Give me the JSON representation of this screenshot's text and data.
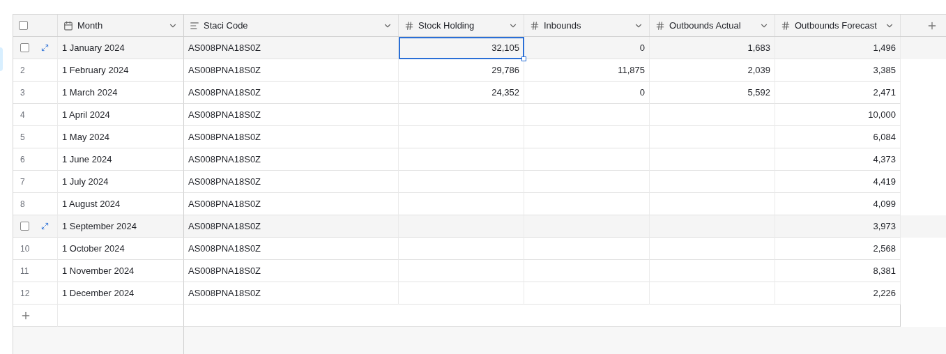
{
  "select_all": {
    "checked": false
  },
  "columns": [
    {
      "label": "Month",
      "kind": "date"
    },
    {
      "label": "Staci Code",
      "kind": "text"
    },
    {
      "label": "Stock Holding",
      "kind": "number"
    },
    {
      "label": "Inbounds",
      "kind": "number"
    },
    {
      "label": "Outbounds Actual",
      "kind": "number"
    },
    {
      "label": "Outbounds Forecast",
      "kind": "number"
    }
  ],
  "rows": [
    {
      "hovered": true,
      "month": "1 January 2024",
      "code": "AS008PNA18S0Z",
      "values": [
        {
          "text": "32,105",
          "selected": true
        },
        {
          "text": "0",
          "selected": false
        },
        {
          "text": "1,683",
          "selected": false
        },
        {
          "text": "1,496",
          "selected": false
        }
      ]
    },
    {
      "number": "2",
      "hovered": false,
      "month": "1 February 2024",
      "code": "AS008PNA18S0Z",
      "values": [
        {
          "text": "29,786",
          "selected": false
        },
        {
          "text": "11,875",
          "selected": false
        },
        {
          "text": "2,039",
          "selected": false
        },
        {
          "text": "3,385",
          "selected": false
        }
      ]
    },
    {
      "number": "3",
      "hovered": false,
      "month": "1 March 2024",
      "code": "AS008PNA18S0Z",
      "values": [
        {
          "text": "24,352",
          "selected": false
        },
        {
          "text": "0",
          "selected": false
        },
        {
          "text": "5,592",
          "selected": false
        },
        {
          "text": "2,471",
          "selected": false
        }
      ]
    },
    {
      "number": "4",
      "hovered": false,
      "month": "1 April 2024",
      "code": "AS008PNA18S0Z",
      "values": [
        {
          "selected": false
        },
        {
          "selected": false
        },
        {
          "selected": false
        },
        {
          "text": "10,000",
          "selected": false
        }
      ]
    },
    {
      "number": "5",
      "hovered": false,
      "month": "1 May 2024",
      "code": "AS008PNA18S0Z",
      "values": [
        {
          "selected": false
        },
        {
          "selected": false
        },
        {
          "selected": false
        },
        {
          "text": "6,084",
          "selected": false
        }
      ]
    },
    {
      "number": "6",
      "hovered": false,
      "month": "1 June 2024",
      "code": "AS008PNA18S0Z",
      "values": [
        {
          "selected": false
        },
        {
          "selected": false
        },
        {
          "selected": false
        },
        {
          "text": "4,373",
          "selected": false
        }
      ]
    },
    {
      "number": "7",
      "hovered": false,
      "month": "1 July 2024",
      "code": "AS008PNA18S0Z",
      "values": [
        {
          "selected": false
        },
        {
          "selected": false
        },
        {
          "selected": false
        },
        {
          "text": "4,419",
          "selected": false
        }
      ]
    },
    {
      "number": "8",
      "hovered": false,
      "month": "1 August 2024",
      "code": "AS008PNA18S0Z",
      "values": [
        {
          "selected": false
        },
        {
          "selected": false
        },
        {
          "selected": false
        },
        {
          "text": "4,099",
          "selected": false
        }
      ]
    },
    {
      "hovered": true,
      "month": "1 September 2024",
      "code": "AS008PNA18S0Z",
      "values": [
        {
          "selected": false
        },
        {
          "selected": false
        },
        {
          "selected": false
        },
        {
          "text": "3,973",
          "selected": false
        }
      ]
    },
    {
      "number": "10",
      "hovered": false,
      "month": "1 October 2024",
      "code": "AS008PNA18S0Z",
      "values": [
        {
          "selected": false
        },
        {
          "selected": false
        },
        {
          "selected": false
        },
        {
          "text": "2,568",
          "selected": false
        }
      ]
    },
    {
      "number": "11",
      "hovered": false,
      "month": "1 November 2024",
      "code": "AS008PNA18S0Z",
      "values": [
        {
          "selected": false
        },
        {
          "selected": false
        },
        {
          "selected": false
        },
        {
          "text": "8,381",
          "selected": false
        }
      ]
    },
    {
      "number": "12",
      "hovered": false,
      "month": "1 December 2024",
      "code": "AS008PNA18S0Z",
      "values": [
        {
          "selected": false
        },
        {
          "selected": false
        },
        {
          "selected": false
        },
        {
          "text": "2,226",
          "selected": false
        }
      ]
    }
  ]
}
